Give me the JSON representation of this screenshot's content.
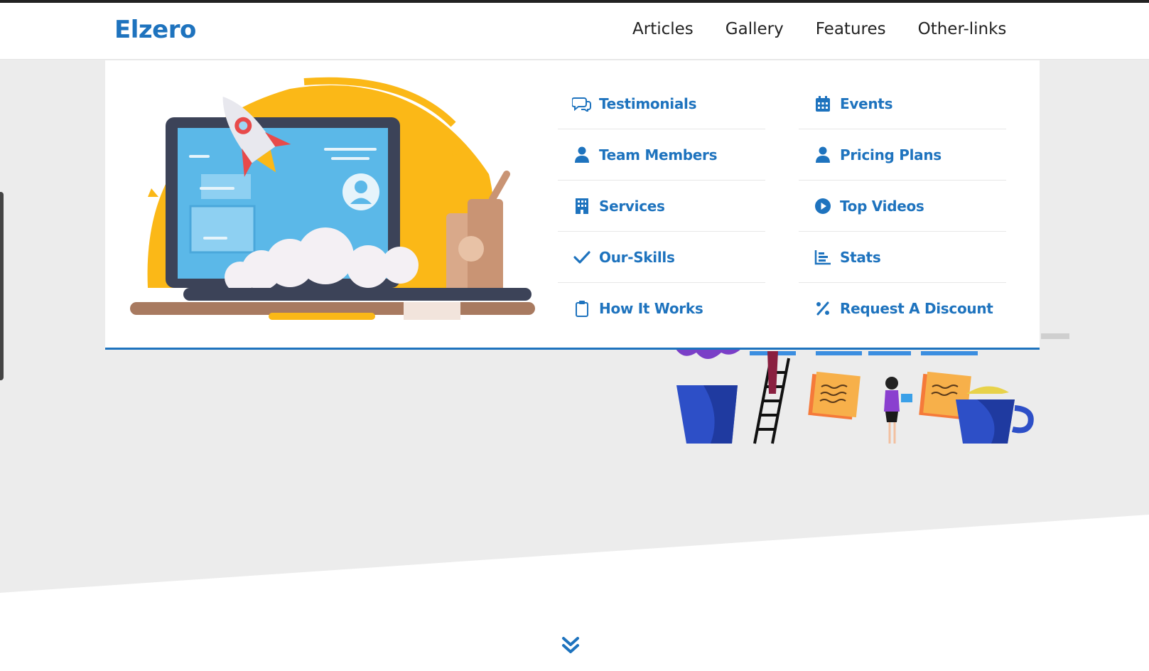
{
  "brand": {
    "logo": "Elzero",
    "accent": "#1e73be"
  },
  "nav": {
    "items": [
      {
        "label": "Articles"
      },
      {
        "label": "Gallery"
      },
      {
        "label": "Features"
      },
      {
        "label": "Other-links"
      }
    ]
  },
  "mega_menu": {
    "columns": [
      [
        {
          "label": "Testimonials",
          "icon": "comments-icon"
        },
        {
          "label": "Team Members",
          "icon": "user-icon"
        },
        {
          "label": "Services",
          "icon": "building-icon"
        },
        {
          "label": "Our-Skills",
          "icon": "check-icon"
        },
        {
          "label": "How It Works",
          "icon": "clipboard-icon"
        }
      ],
      [
        {
          "label": "Events",
          "icon": "calendar-icon"
        },
        {
          "label": "Pricing Plans",
          "icon": "user-icon"
        },
        {
          "label": "Top Videos",
          "icon": "play-circle-icon"
        },
        {
          "label": "Stats",
          "icon": "chart-bar-icon"
        },
        {
          "label": "Request A Discount",
          "icon": "percent-icon"
        }
      ]
    ]
  },
  "landing": {
    "scroll_icon": "double-chevron-down-icon"
  }
}
